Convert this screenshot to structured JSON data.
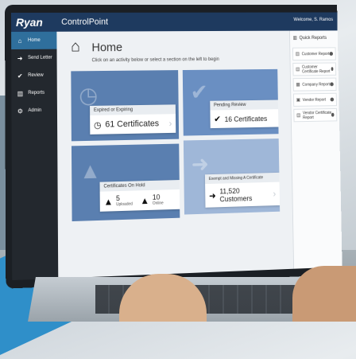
{
  "header": {
    "logo": "Ryan",
    "app_title": "ControlPoint",
    "welcome": "Welcome, S. Ramos"
  },
  "sidebar": {
    "items": [
      {
        "label": "Home",
        "icon": "home-icon",
        "active": true
      },
      {
        "label": "Send Letter",
        "icon": "arrow-right-icon"
      },
      {
        "label": "Review",
        "icon": "check-icon"
      },
      {
        "label": "Reports",
        "icon": "chart-icon"
      },
      {
        "label": "Admin",
        "icon": "gears-icon"
      }
    ]
  },
  "main": {
    "title": "Home",
    "subtitle": "Click on an activity below or select a section on the left to begin",
    "tiles": {
      "expired": {
        "label": "Expired or Expiring",
        "value": "61 Certificates"
      },
      "pending": {
        "label": "Pending Review",
        "value": "16 Certificates"
      },
      "onhold": {
        "label": "Certificates On Hold",
        "uploaded_value": "5",
        "uploaded_label": "Uploaded",
        "online_value": "10",
        "online_label": "Online"
      },
      "exempt": {
        "label": "Exempt and Missing A Certificate",
        "value": "11,520 Customers"
      }
    }
  },
  "quick_reports": {
    "title": "Quick Reports",
    "items": [
      {
        "label": "Customer Report"
      },
      {
        "label": "Customer Certificate Report"
      },
      {
        "label": "Company Report"
      },
      {
        "label": "Vendor Report"
      },
      {
        "label": "Vendor Certificate Report"
      }
    ]
  },
  "colors": {
    "topbar": "#1e3a5f",
    "sidebar": "#23282e",
    "active": "#2f6f9c",
    "tile": "#5a7fb0"
  }
}
